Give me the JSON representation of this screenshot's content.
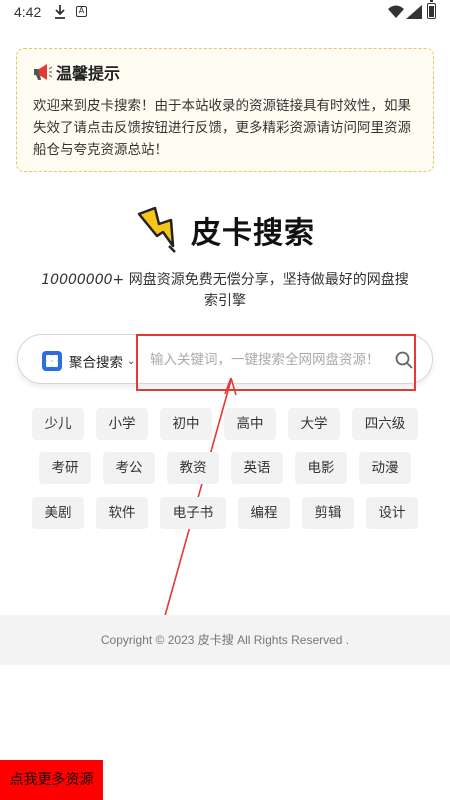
{
  "status_bar": {
    "time": "4:42",
    "icons": [
      "download-icon",
      "a-icon",
      "wifi-icon",
      "signal-icon",
      "battery-icon"
    ]
  },
  "notice": {
    "icon": "megaphone-icon",
    "title": "温馨提示",
    "text": "欢迎来到皮卡搜索！由于本站收录的资源链接具有时效性，如果失效了请点击反馈按钮进行反馈，更多精彩资源请访问阿里资源船仓与夸克资源总站！"
  },
  "brand": {
    "logo_icon": "lightning-bolt-icon",
    "name": "皮卡搜索",
    "slogan_number": "10000000+",
    "slogan_text": " 网盘资源免费无偿分享，坚持做最好的网盘搜索引擎"
  },
  "search": {
    "scope_icon": "grid-icon",
    "scope_label": "聚合搜索",
    "placeholder": "输入关键词，一键搜索全网网盘资源！",
    "value": "",
    "button_icon": "search-icon"
  },
  "tags": [
    "少儿",
    "小学",
    "初中",
    "高中",
    "大学",
    "四六级",
    "考研",
    "考公",
    "教资",
    "英语",
    "电影",
    "动漫",
    "美剧",
    "软件",
    "电子书",
    "编程",
    "剪辑",
    "设计"
  ],
  "footer": {
    "copyright": "Copyright © 2023 皮卡搜 All Rights Reserved ."
  },
  "more_button": {
    "label": "点我更多资源"
  },
  "colors": {
    "accent_blue": "#2a6fdb",
    "notice_border": "#e8c46a",
    "annotation_red": "#e53935",
    "more_button_bg": "#ff0000"
  }
}
